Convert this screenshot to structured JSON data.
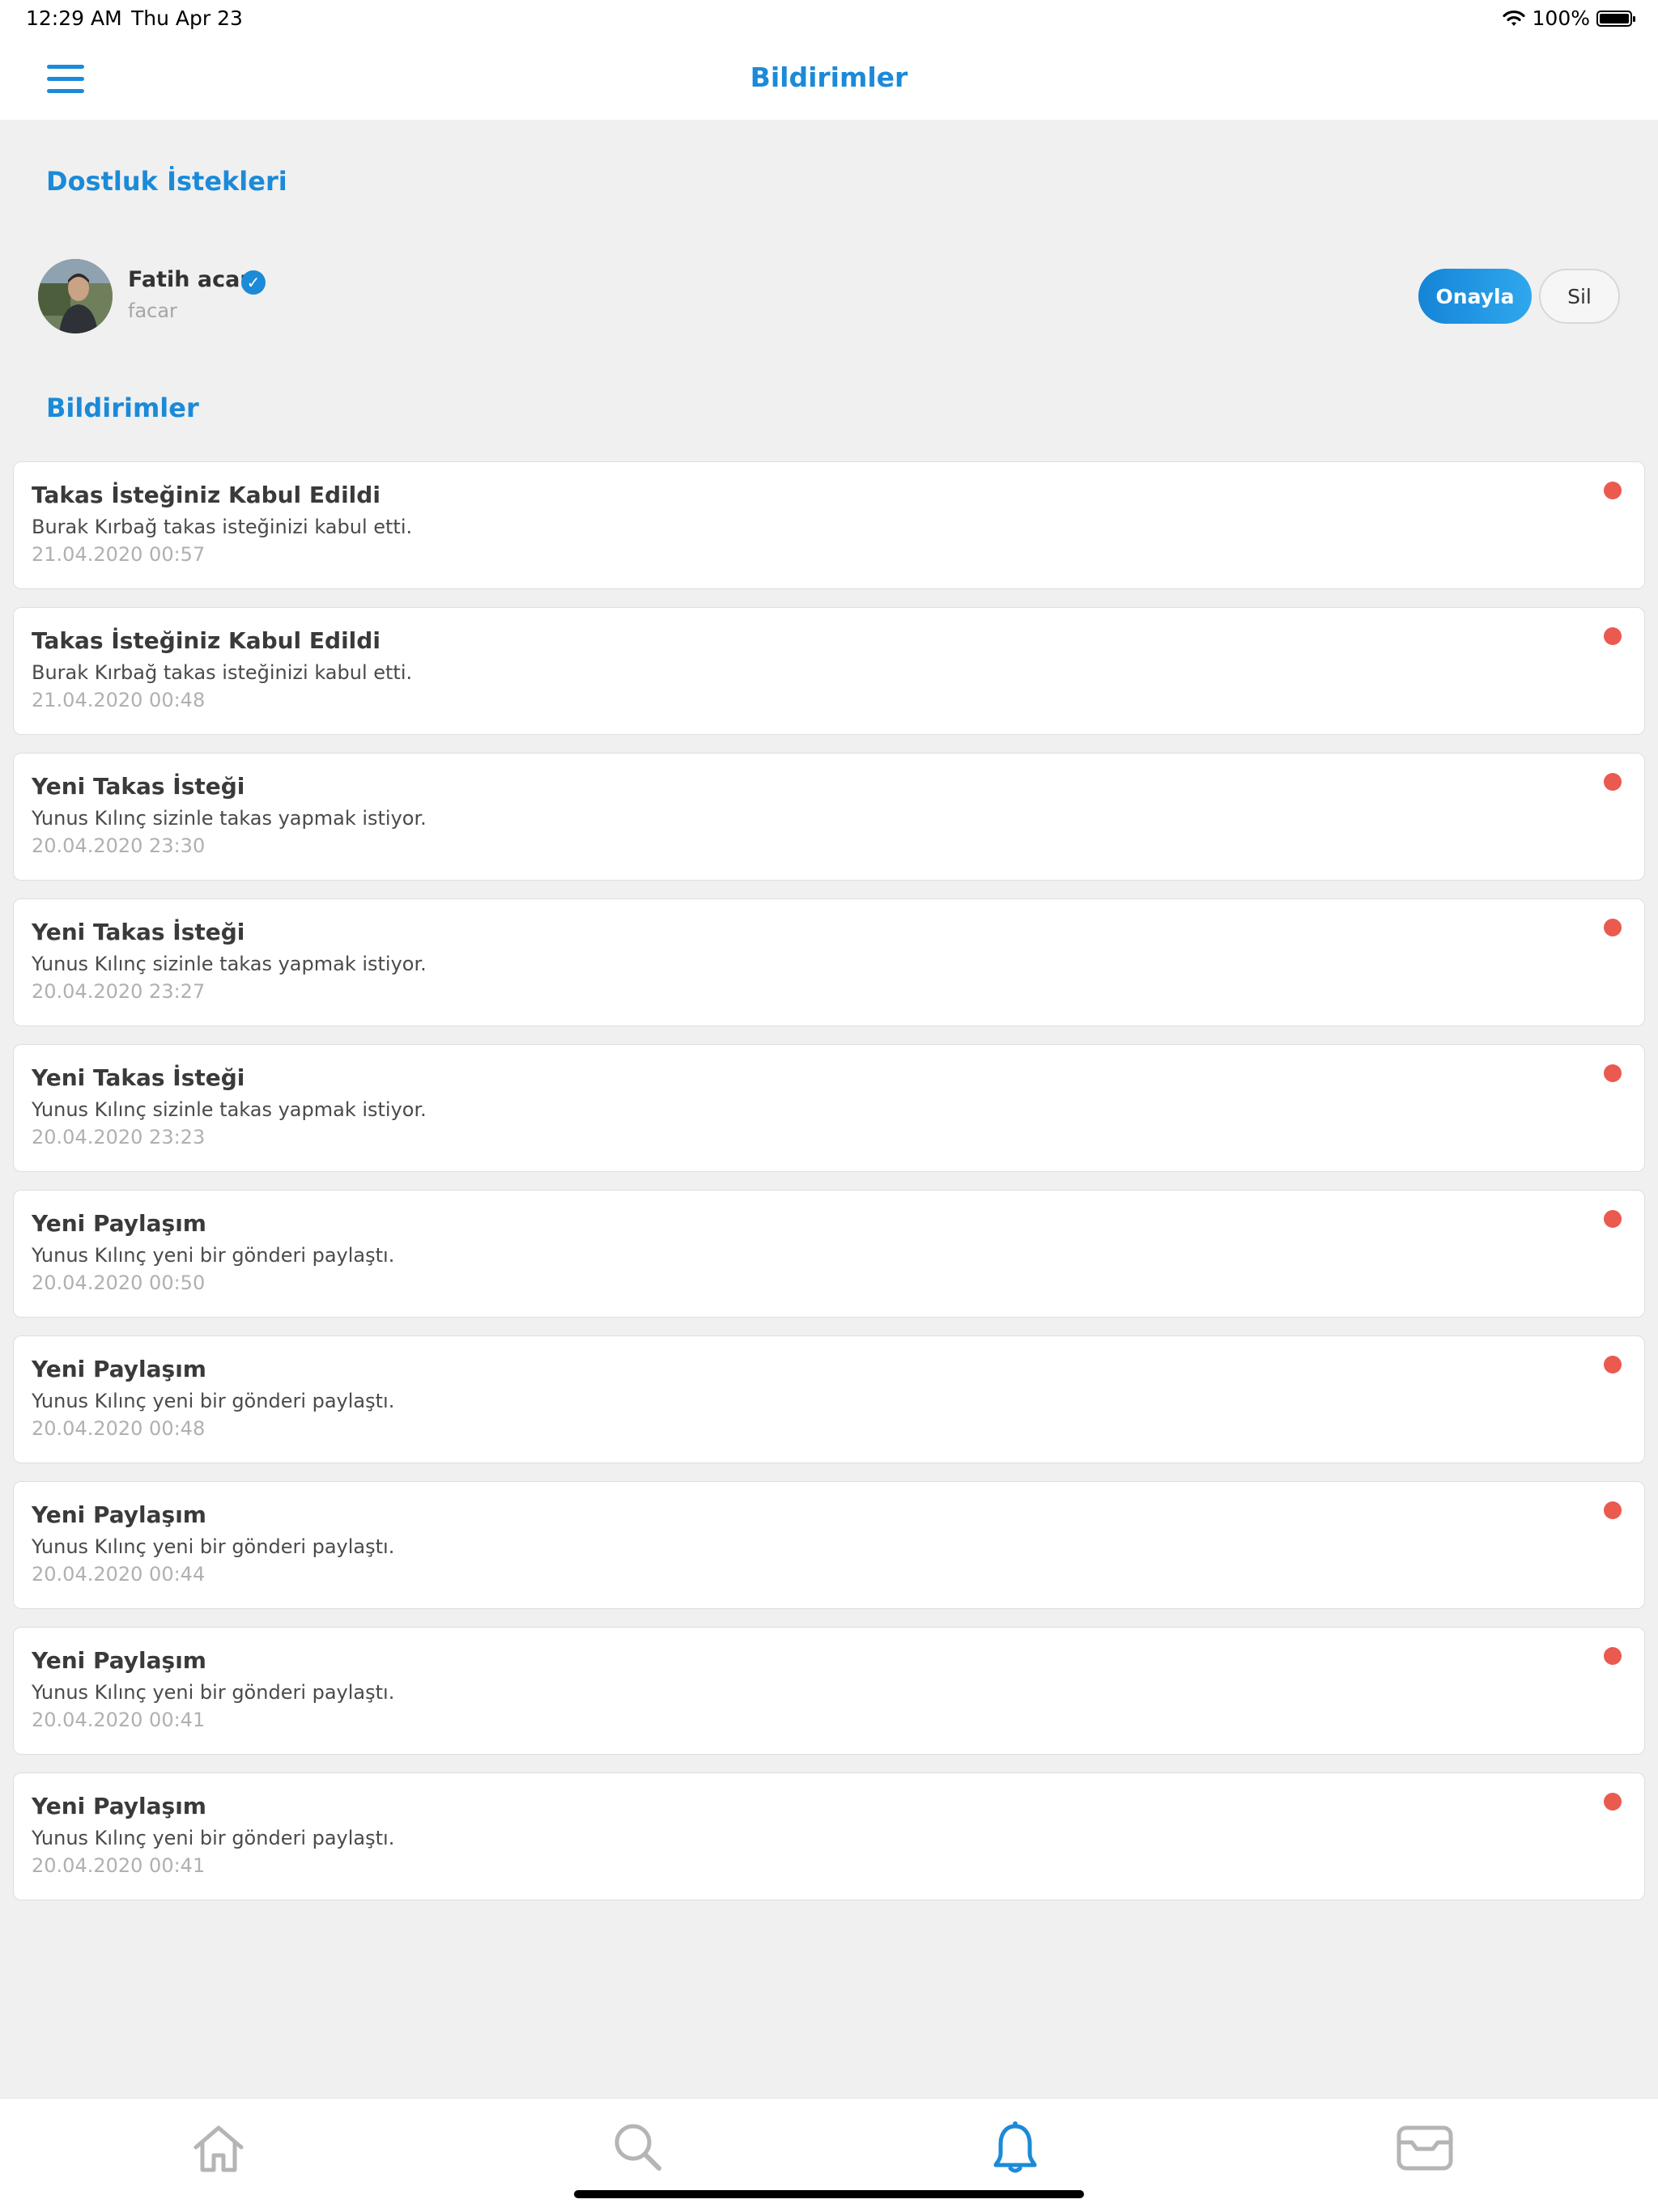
{
  "status_bar": {
    "time": "12:29 AM",
    "date": "Thu Apr 23",
    "battery": "100%"
  },
  "nav": {
    "title": "Bildirimler",
    "menu_icon": "hamburger-menu-icon"
  },
  "friend_requests": {
    "title": "Dostluk İstekleri",
    "items": [
      {
        "name": "Fatih acar",
        "username": "facar",
        "approve_label": "Onayla",
        "delete_label": "Sil"
      }
    ]
  },
  "notifications": {
    "title": "Bildirimler",
    "items": [
      {
        "title": "Takas İsteğiniz Kabul Edildi",
        "body": "Burak Kırbağ takas isteğinizi kabul etti.",
        "date": "21.04.2020 00:57"
      },
      {
        "title": "Takas İsteğiniz Kabul Edildi",
        "body": "Burak Kırbağ takas isteğinizi kabul etti.",
        "date": "21.04.2020 00:48"
      },
      {
        "title": "Yeni Takas İsteği",
        "body": "Yunus Kılınç sizinle takas yapmak istiyor.",
        "date": "20.04.2020 23:30"
      },
      {
        "title": "Yeni Takas İsteği",
        "body": "Yunus Kılınç sizinle takas yapmak istiyor.",
        "date": "20.04.2020 23:27"
      },
      {
        "title": "Yeni Takas İsteği",
        "body": "Yunus Kılınç sizinle takas yapmak istiyor.",
        "date": "20.04.2020 23:23"
      },
      {
        "title": "Yeni Paylaşım",
        "body": "Yunus Kılınç yeni bir gönderi paylaştı.",
        "date": "20.04.2020 00:50"
      },
      {
        "title": "Yeni Paylaşım",
        "body": "Yunus Kılınç yeni bir gönderi paylaştı.",
        "date": "20.04.2020 00:48"
      },
      {
        "title": "Yeni Paylaşım",
        "body": "Yunus Kılınç yeni bir gönderi paylaştı.",
        "date": "20.04.2020 00:44"
      },
      {
        "title": "Yeni Paylaşım",
        "body": "Yunus Kılınç yeni bir gönderi paylaştı.",
        "date": "20.04.2020 00:41"
      },
      {
        "title": "Yeni Paylaşım",
        "body": "Yunus Kılınç yeni bir gönderi paylaştı.",
        "date": "20.04.2020 00:41"
      }
    ]
  },
  "tab_bar": {
    "tabs": [
      {
        "icon": "home-icon",
        "active": false
      },
      {
        "icon": "search-icon",
        "active": false
      },
      {
        "icon": "bell-icon",
        "active": true
      },
      {
        "icon": "inbox-icon",
        "active": false
      }
    ]
  },
  "colors": {
    "accent": "#1b8ad8",
    "unread_dot": "#ea5a4f",
    "background": "#f0f0f0",
    "inactive_icon": "#b5b5b5"
  }
}
